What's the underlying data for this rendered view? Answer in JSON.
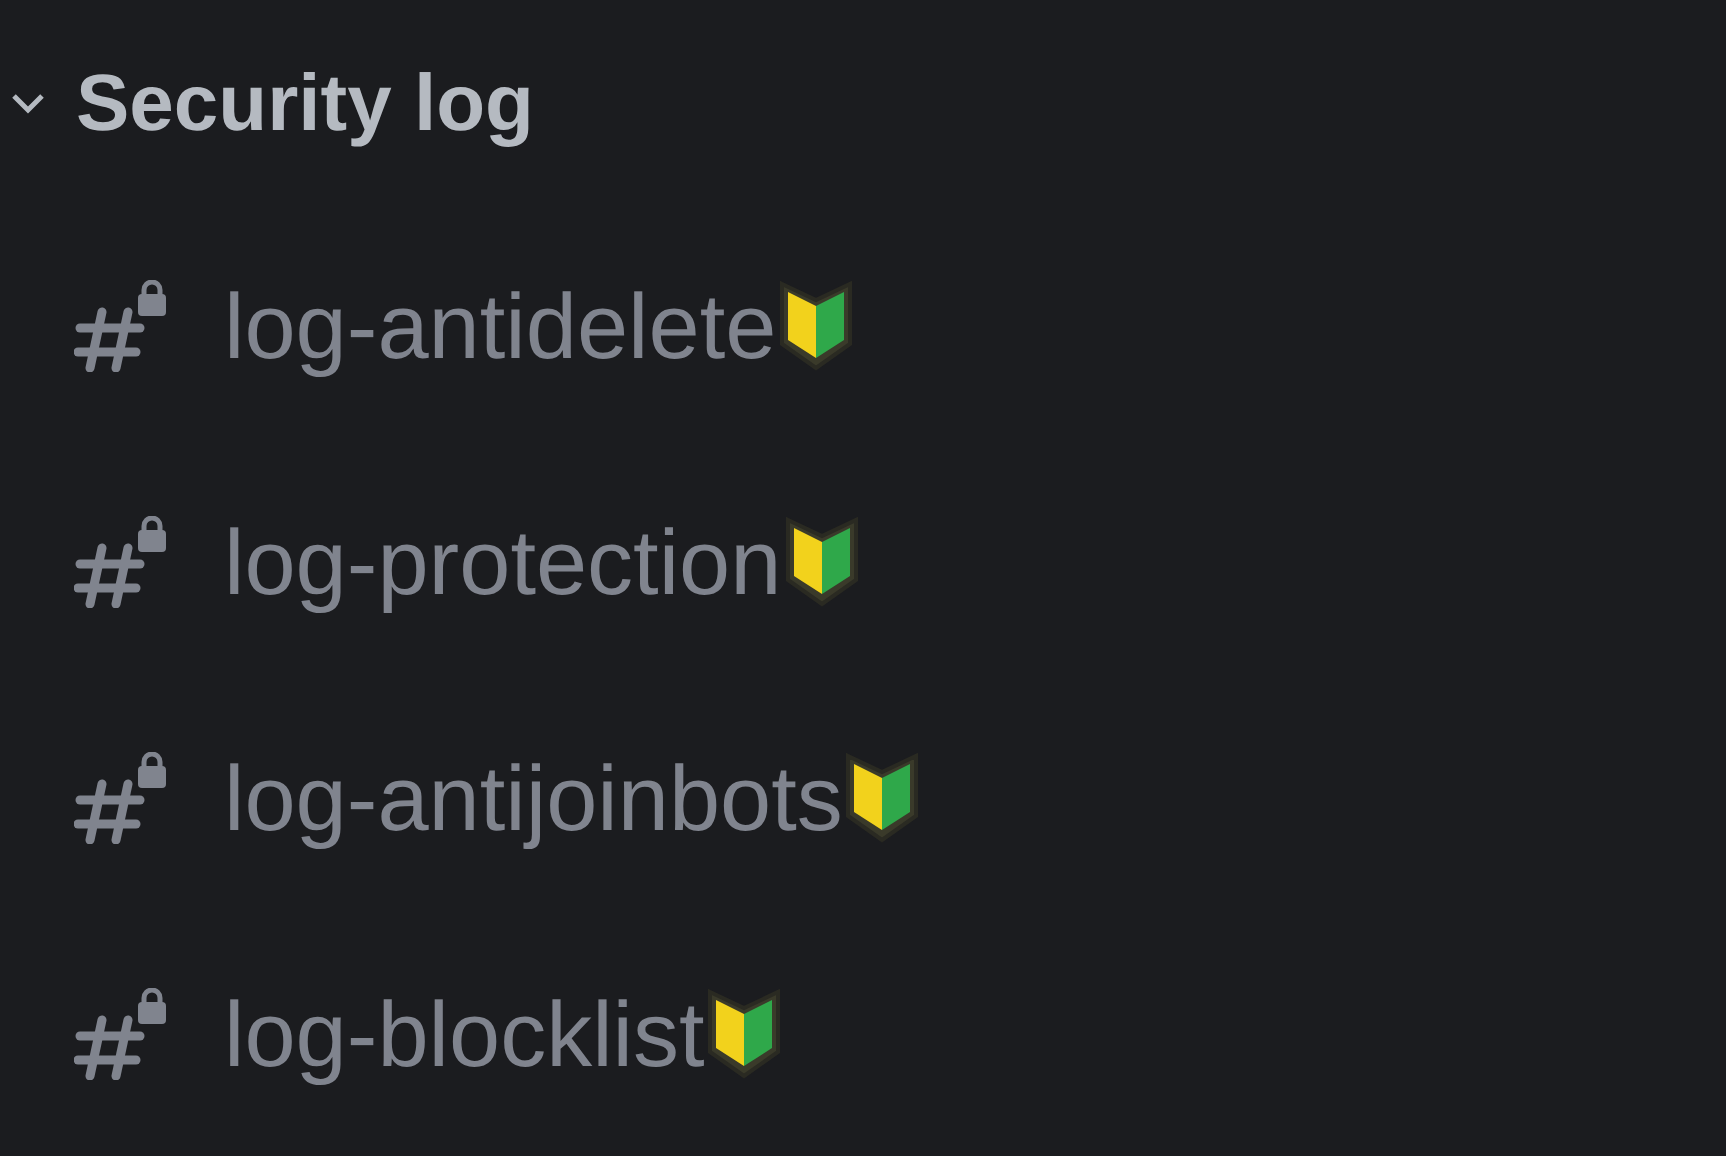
{
  "category": {
    "title": "Security log",
    "expanded": true
  },
  "channels": [
    {
      "name": "log-antidelete",
      "locked": true
    },
    {
      "name": "log-protection",
      "locked": true
    },
    {
      "name": "log-antijoinbots",
      "locked": true
    },
    {
      "name": "log-blocklist",
      "locked": true
    }
  ]
}
